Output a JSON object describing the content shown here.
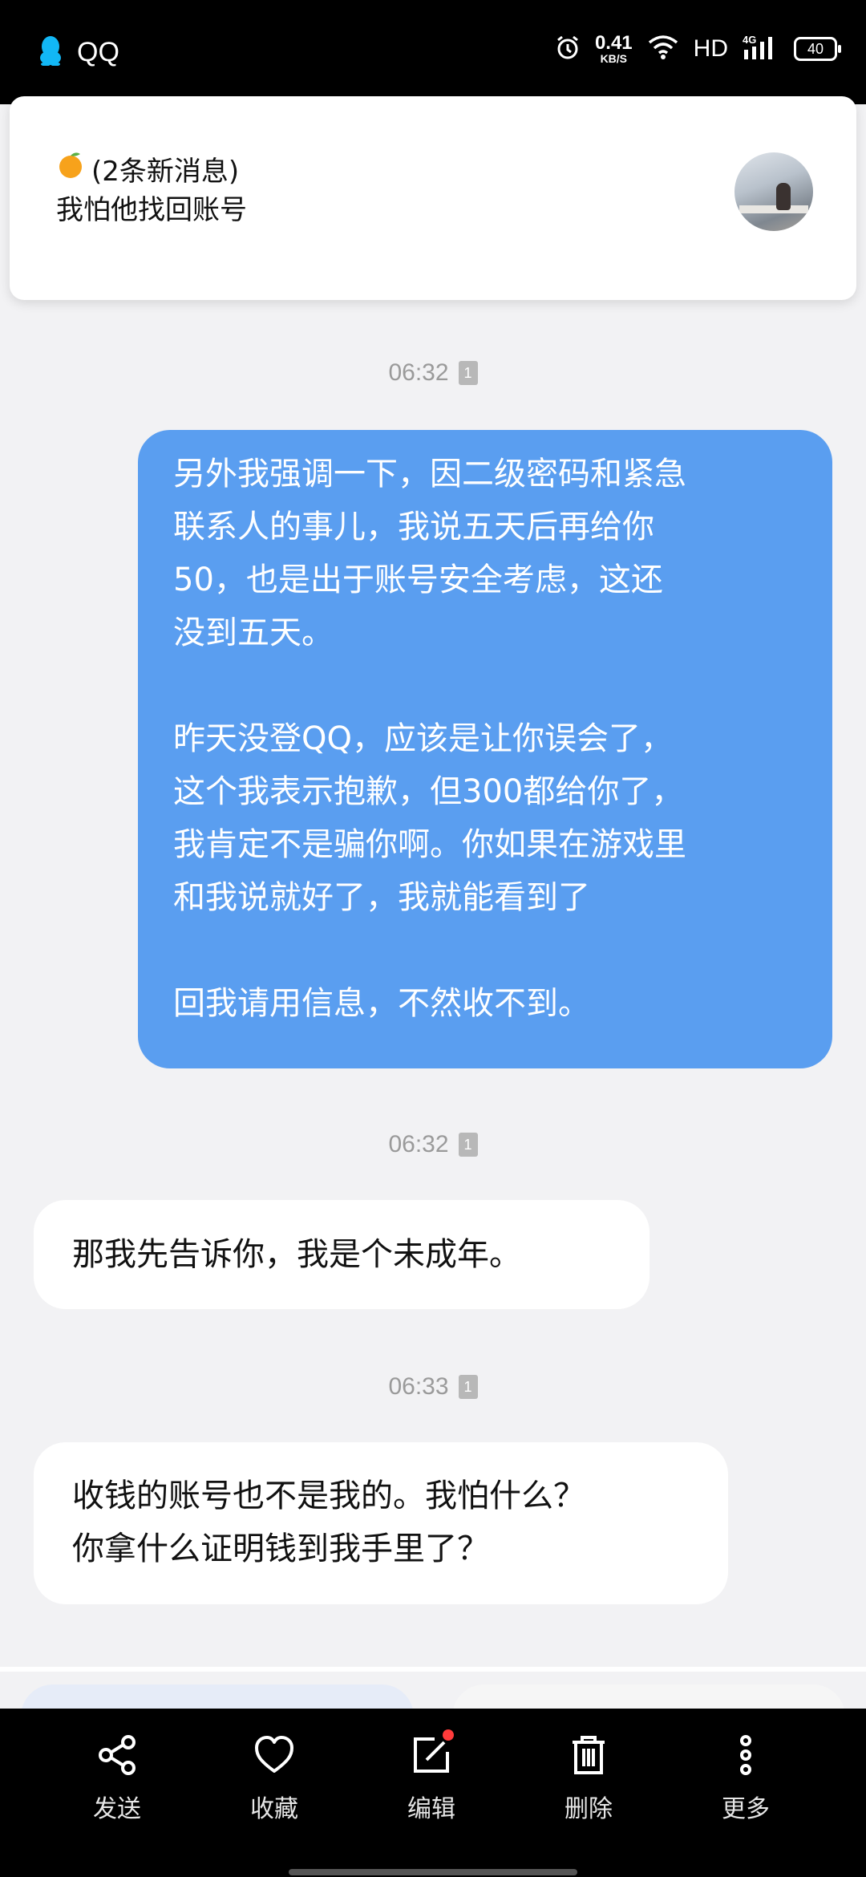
{
  "status_bar": {
    "app_name": "QQ",
    "speed_value": "0.41",
    "speed_unit": "KB/S",
    "network": "HD",
    "signal": "4G",
    "battery": "40"
  },
  "notification": {
    "title": "(2条新消息)",
    "body": "我怕他找回账号"
  },
  "messages": [
    {
      "time": "06:32",
      "direction": "out",
      "paragraphs": [
        [
          "另外我强调一下，因二级密码和紧急",
          "联系人的事儿，我说五天后再给你",
          "50，也是出于账号安全考虑，这还",
          "没到五天。"
        ],
        [
          "昨天没登QQ，应该是让你误会了，",
          "这个我表示抱歉，但300都给你了，",
          "我肯定不是骗你啊。你如果在游戏里",
          "和我说就好了，我就能看到了"
        ],
        [
          "回我请用信息，不然收不到。"
        ]
      ]
    },
    {
      "time": "06:32",
      "direction": "in",
      "lines": [
        "那我先告诉你，我是个未成年。"
      ]
    },
    {
      "time": "06:33",
      "direction": "in",
      "lines": [
        "收钱的账号也不是我的。我怕什么？",
        "你拿什么证明钱到我手里了？"
      ]
    }
  ],
  "toolbar": {
    "send": "发送",
    "favorite": "收藏",
    "edit": "编辑",
    "delete": "删除",
    "more": "更多"
  },
  "colors": {
    "bubble_out": "#5a9ef0",
    "bubble_in": "#ffffff",
    "background": "#f2f2f4"
  }
}
